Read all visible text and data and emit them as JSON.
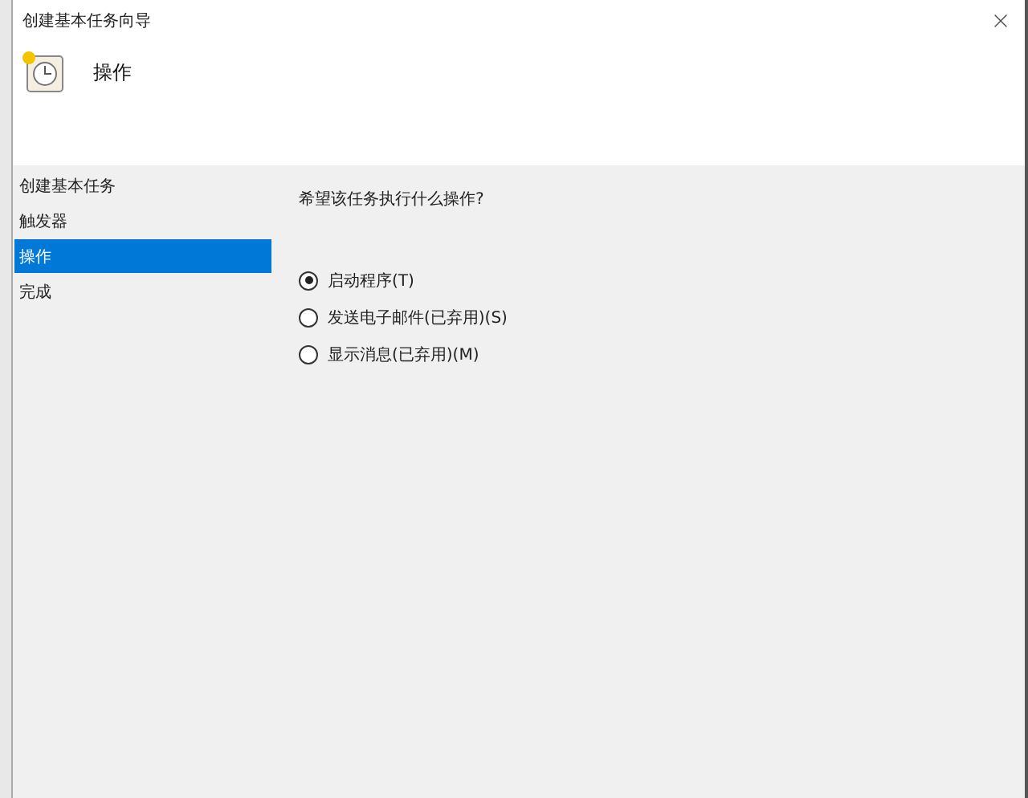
{
  "window": {
    "title": "创建基本任务向导"
  },
  "header": {
    "title": "操作"
  },
  "sidebar": {
    "items": [
      {
        "label": "创建基本任务",
        "selected": false
      },
      {
        "label": "触发器",
        "selected": false
      },
      {
        "label": "操作",
        "selected": true
      },
      {
        "label": "完成",
        "selected": false
      }
    ]
  },
  "question": "希望该任务执行什么操作?",
  "options": [
    {
      "label": "启动程序(T)",
      "selected": true
    },
    {
      "label": "发送电子邮件(已弃用)(S)",
      "selected": false
    },
    {
      "label": "显示消息(已弃用)(M)",
      "selected": false
    }
  ]
}
